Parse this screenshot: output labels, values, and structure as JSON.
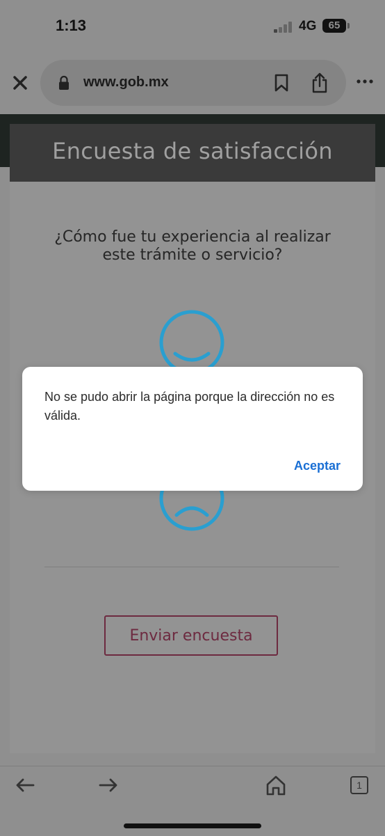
{
  "status_bar": {
    "time": "1:13",
    "network": "4G",
    "battery": "65"
  },
  "browser": {
    "url": "www.gob.mx",
    "tab_count": "1"
  },
  "survey": {
    "title": "Encuesta de satisfacción",
    "question": "¿Cómo fue tu experiencia al realizar este trámite o servicio?",
    "submit_label": "Enviar encuesta",
    "accent_color": "#2a9fd0",
    "submit_color": "#6d2a40"
  },
  "dialog": {
    "message": "No se pudo abrir la página porque la dirección no es válida.",
    "accept_label": "Aceptar",
    "accent_color": "#1a6fd4"
  },
  "icons": [
    "close-icon",
    "lock-icon",
    "bookmark-icon",
    "share-icon",
    "more-icon",
    "back-icon",
    "forward-icon",
    "home-icon",
    "tabs-icon",
    "happy-face-icon",
    "sad-face-icon"
  ]
}
